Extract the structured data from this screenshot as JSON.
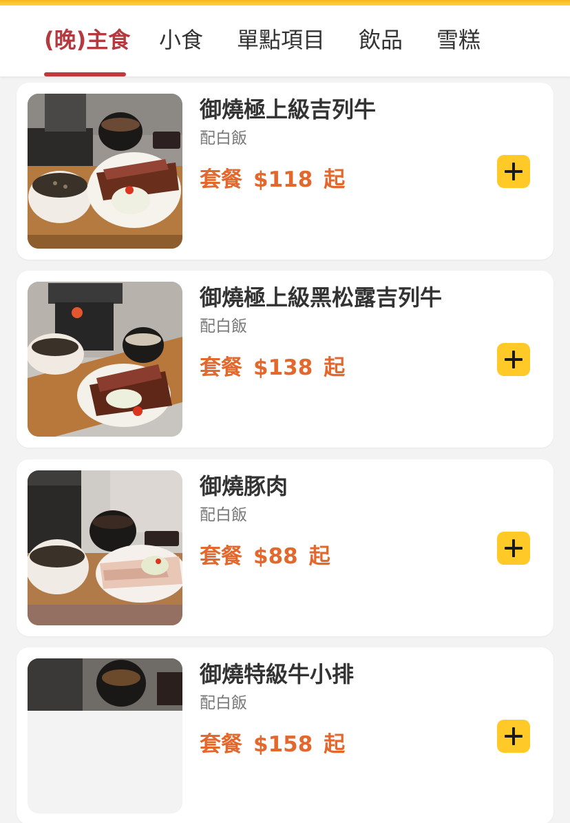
{
  "tabs": [
    {
      "label": "(晚)主食"
    },
    {
      "label": "小食"
    },
    {
      "label": "單點項目"
    },
    {
      "label": "飲品"
    },
    {
      "label": "雪糕"
    }
  ],
  "active_tab": "(晚)主食",
  "colors": {
    "accent_tab": "#b33b3f",
    "price": "#e2682d",
    "add_button": "#ffc928",
    "top_strip": "#ffd23f"
  },
  "items": [
    {
      "name": "御燒極上級吉列牛",
      "subtitle": "配白飯",
      "price_prefix": "套餐",
      "price": "$118",
      "price_suffix": "起",
      "image_loaded": "full"
    },
    {
      "name": "御燒極上級黑松露吉列牛",
      "subtitle": "配白飯",
      "price_prefix": "套餐",
      "price": "$138",
      "price_suffix": "起",
      "image_loaded": "full"
    },
    {
      "name": "御燒豚肉",
      "subtitle": "配白飯",
      "price_prefix": "套餐",
      "price": "$88",
      "price_suffix": "起",
      "image_loaded": "full"
    },
    {
      "name": "御燒特級牛小排",
      "subtitle": "配白飯",
      "price_prefix": "套餐",
      "price": "$158",
      "price_suffix": "起",
      "image_loaded": "partial"
    }
  ],
  "icons": {
    "add": "plus-icon"
  }
}
